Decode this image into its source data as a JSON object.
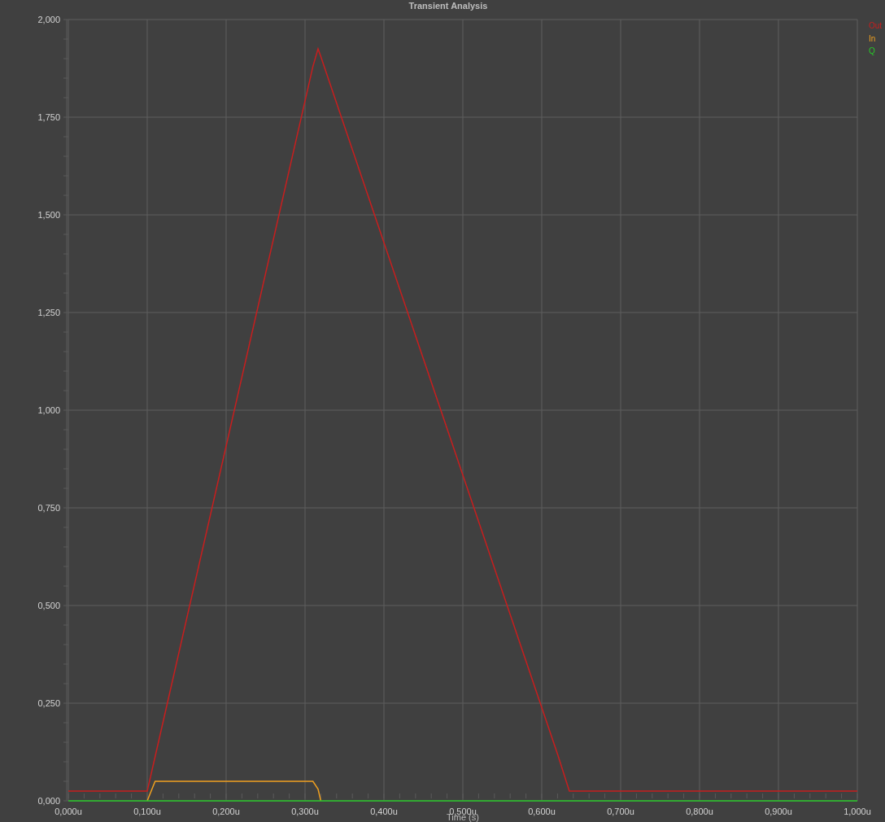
{
  "chart": {
    "chart_data": {
      "type": "line",
      "title": "Transient Analysis",
      "xlabel": "Time (s)",
      "x": [
        0,
        0.1,
        0.11,
        0.31,
        0.3165,
        0.32,
        0.62,
        0.635,
        1.0
      ],
      "series": [
        {
          "name": "Out",
          "color": "#c81e1e",
          "values": [
            0.025,
            0.025,
            0.113,
            1.88,
            1.925,
            1.905,
            0.12,
            0.025,
            0.025
          ]
        },
        {
          "name": "In",
          "color": "#f0a020",
          "values": [
            null,
            0,
            0.05,
            0.05,
            0.03,
            0,
            null,
            null,
            null
          ]
        },
        {
          "name": "Q",
          "color": "#28c828",
          "values": [
            0,
            0,
            0,
            0,
            0,
            0,
            0,
            0,
            0
          ]
        }
      ],
      "xlim": [
        0,
        1
      ],
      "ylim": [
        0,
        2
      ],
      "grid": true,
      "xticks": [
        {
          "value": 0,
          "label": "0,000u"
        },
        {
          "value": 0.1,
          "label": "0,100u"
        },
        {
          "value": 0.2,
          "label": "0,200u"
        },
        {
          "value": 0.3,
          "label": "0,300u"
        },
        {
          "value": 0.4,
          "label": "0,400u"
        },
        {
          "value": 0.5,
          "label": "0,500u"
        },
        {
          "value": 0.6,
          "label": "0,600u"
        },
        {
          "value": 0.7,
          "label": "0,700u"
        },
        {
          "value": 0.8,
          "label": "0,800u"
        },
        {
          "value": 0.9,
          "label": "0,900u"
        },
        {
          "value": 1,
          "label": "1,000u"
        }
      ],
      "yticks": [
        {
          "value": 0,
          "label": "0,000"
        },
        {
          "value": 0.25,
          "label": "0,250"
        },
        {
          "value": 0.5,
          "label": "0,500"
        },
        {
          "value": 0.75,
          "label": "0,750"
        },
        {
          "value": 1,
          "label": "1,000"
        },
        {
          "value": 1.25,
          "label": "1,250"
        },
        {
          "value": 1.5,
          "label": "1,500"
        },
        {
          "value": 1.75,
          "label": "1,750"
        },
        {
          "value": 2,
          "label": "2,000"
        }
      ]
    }
  }
}
